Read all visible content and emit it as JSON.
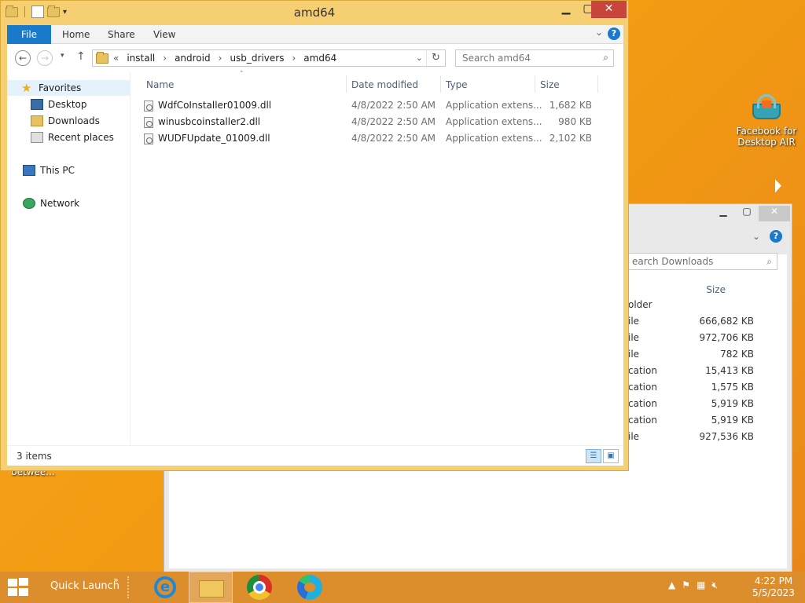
{
  "desktop": {
    "icon_label_line1": "Facebook for",
    "icon_label_line2": "Desktop AIR",
    "partial_label": "betwee..."
  },
  "bg_window": {
    "search_placeholder": "earch Downloads",
    "size_header": "Size",
    "rows": [
      {
        "label": "older",
        "size": ""
      },
      {
        "label": "ile",
        "size": "666,682 KB"
      },
      {
        "label": "ile",
        "size": "972,706 KB"
      },
      {
        "label": "ile",
        "size": "782 KB"
      },
      {
        "label": "cation",
        "size": "15,413 KB"
      },
      {
        "label": "cation",
        "size": "1,575 KB"
      },
      {
        "label": "cation",
        "size": "5,919 KB"
      },
      {
        "label": "cation",
        "size": "5,919 KB"
      },
      {
        "label": "ile",
        "size": "927,536 KB"
      }
    ]
  },
  "window": {
    "title": "amd64",
    "ribbon_tabs": [
      "File",
      "Home",
      "Share",
      "View"
    ],
    "breadcrumb": [
      "install",
      "android",
      "usb_drivers",
      "amd64"
    ],
    "search_placeholder": "Search amd64",
    "columns": [
      "Name",
      "Date modified",
      "Type",
      "Size"
    ],
    "files": [
      {
        "name": "WdfCoInstaller01009.dll",
        "date": "4/8/2022 2:50 AM",
        "type": "Application extens...",
        "size": "1,682 KB"
      },
      {
        "name": "winusbcoinstaller2.dll",
        "date": "4/8/2022 2:50 AM",
        "type": "Application extens...",
        "size": "980 KB"
      },
      {
        "name": "WUDFUpdate_01009.dll",
        "date": "4/8/2022 2:50 AM",
        "type": "Application extens...",
        "size": "2,102 KB"
      }
    ],
    "nav": {
      "favorites": "Favorites",
      "desktop": "Desktop",
      "downloads": "Downloads",
      "recent": "Recent places",
      "this_pc": "This PC",
      "network": "Network"
    },
    "status": "3 items"
  },
  "taskbar": {
    "quick_launch": "Quick Launch",
    "time": "4:22 PM",
    "date": "5/5/2023"
  },
  "colors": {
    "accent": "#1979ca",
    "window_frame": "#f6cf73",
    "desktop": "#f39c12",
    "close": "#c7453a"
  }
}
